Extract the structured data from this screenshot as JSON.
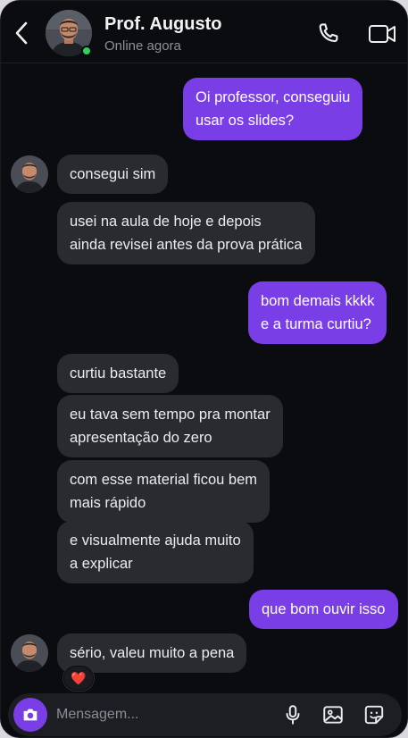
{
  "contact": {
    "name": "Prof. Augusto",
    "status": "Online agora"
  },
  "icons": {
    "back": "chevron-left-icon",
    "call": "phone-icon",
    "video": "video-camera-icon",
    "camera": "camera-icon",
    "mic": "microphone-icon",
    "gallery": "image-icon",
    "sticker": "sticker-icon"
  },
  "colors": {
    "accent": "#7a3ee6",
    "incoming_bubble": "#2a2b30",
    "background": "#0b0c10",
    "online": "#2fd15a"
  },
  "messages": [
    {
      "from": "me",
      "lines": [
        "Oi professor, conseguiu",
        "usar os slides?"
      ]
    },
    {
      "from": "them",
      "lines": [
        "consegui sim"
      ]
    },
    {
      "from": "them",
      "lines": [
        "usei na aula de hoje e depois",
        "ainda revisei antes da prova prática"
      ]
    },
    {
      "from": "me",
      "lines": [
        "bom demais kkkk",
        "e a turma curtiu?"
      ]
    },
    {
      "from": "them",
      "lines": [
        "curtiu bastante"
      ]
    },
    {
      "from": "them",
      "lines": [
        "eu tava sem tempo pra montar",
        "apresentação do zero"
      ]
    },
    {
      "from": "them",
      "lines": [
        "com esse material ficou bem",
        "mais rápido"
      ]
    },
    {
      "from": "them",
      "lines": [
        "e visualmente ajuda muito",
        "a explicar"
      ]
    },
    {
      "from": "me",
      "lines": [
        "que bom ouvir isso"
      ]
    },
    {
      "from": "them",
      "lines": [
        "sério, valeu muito a pena"
      ],
      "reaction": "❤️"
    }
  ],
  "composer": {
    "placeholder": "Mensagem..."
  }
}
